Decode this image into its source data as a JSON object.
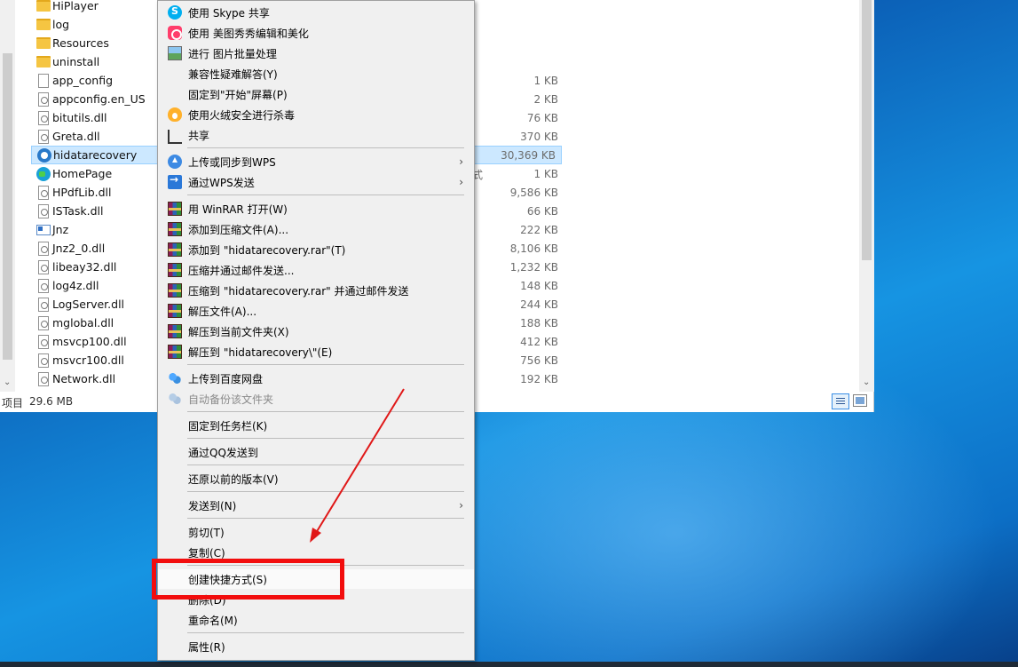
{
  "files": [
    {
      "name": "HiPlayer",
      "size": "",
      "icon": "folder-icon"
    },
    {
      "name": "log",
      "size": "",
      "icon": "folder-icon"
    },
    {
      "name": "Resources",
      "size": "",
      "icon": "folder-icon"
    },
    {
      "name": "uninstall",
      "size": "",
      "icon": "folder-icon"
    },
    {
      "name": "app_config",
      "size": "1 KB",
      "icon": "file-icon"
    },
    {
      "name": "appconfig.en_US",
      "size": "2 KB",
      "icon": "config-file-icon"
    },
    {
      "name": "bitutils.dll",
      "size": "76 KB",
      "icon": "dll-icon"
    },
    {
      "name": "Greta.dll",
      "size": "370 KB",
      "icon": "dll-icon"
    },
    {
      "name": "hidatarecovery",
      "size": "30,369 KB",
      "icon": "app-icon"
    },
    {
      "name": "HomePage",
      "size": "1 KB",
      "icon": "edge-shortcut-icon"
    },
    {
      "name": "HPdfLib.dll",
      "size": "9,586 KB",
      "icon": "dll-icon"
    },
    {
      "name": "ISTask.dll",
      "size": "66 KB",
      "icon": "dll-icon"
    },
    {
      "name": "Jnz",
      "size": "222 KB",
      "icon": "window-file-icon"
    },
    {
      "name": "Jnz2_0.dll",
      "size": "8,106 KB",
      "icon": "dll-icon"
    },
    {
      "name": "libeay32.dll",
      "size": "1,232 KB",
      "icon": "dll-icon"
    },
    {
      "name": "log4z.dll",
      "size": "148 KB",
      "icon": "dll-icon"
    },
    {
      "name": "LogServer.dll",
      "size": "244 KB",
      "icon": "dll-icon"
    },
    {
      "name": "mglobal.dll",
      "size": "188 KB",
      "icon": "dll-icon"
    },
    {
      "name": "msvcp100.dll",
      "size": "412 KB",
      "icon": "dll-icon"
    },
    {
      "name": "msvcr100.dll",
      "size": "756 KB",
      "icon": "dll-icon"
    },
    {
      "name": "Network.dll",
      "size": "192 KB",
      "icon": "dll-icon"
    }
  ],
  "type_fragment": "式",
  "status": {
    "count_label": "项目",
    "size": "29.6 MB"
  },
  "menu": {
    "skype": "使用 Skype 共享",
    "meitu": "使用 美图秀秀编辑和美化",
    "batch": "进行 图片批量处理",
    "compat": "兼容性疑难解答(Y)",
    "pin_start": "固定到\"开始\"屏幕(P)",
    "huorong": "使用火绒安全进行杀毒",
    "share": "共享",
    "wps_upload": "上传或同步到WPS",
    "wps_send": "通过WPS发送",
    "winrar_open": "用 WinRAR 打开(W)",
    "add_archive": "添加到压缩文件(A)...",
    "add_rar": "添加到 \"hidatarecovery.rar\"(T)",
    "compress_email": "压缩并通过邮件发送...",
    "compress_rar_email": "压缩到 \"hidatarecovery.rar\" 并通过邮件发送",
    "extract": "解压文件(A)...",
    "extract_here": "解压到当前文件夹(X)",
    "extract_to": "解压到 \"hidatarecovery\\\"(E)",
    "baidu_upload": "上传到百度网盘",
    "baidu_backup": "自动备份该文件夹",
    "pin_taskbar": "固定到任务栏(K)",
    "qq_send": "通过QQ发送到",
    "restore": "还原以前的版本(V)",
    "send_to": "发送到(N)",
    "cut": "剪切(T)",
    "copy": "复制(C)",
    "create_shortcut": "创建快捷方式(S)",
    "delete": "删除(D)",
    "rename": "重命名(M)",
    "properties": "属性(R)",
    "submenu_arrow": "›"
  },
  "colors": {
    "highlight_box": "#f20d0d",
    "arrow": "#e01818",
    "selection": "#cce8ff"
  }
}
